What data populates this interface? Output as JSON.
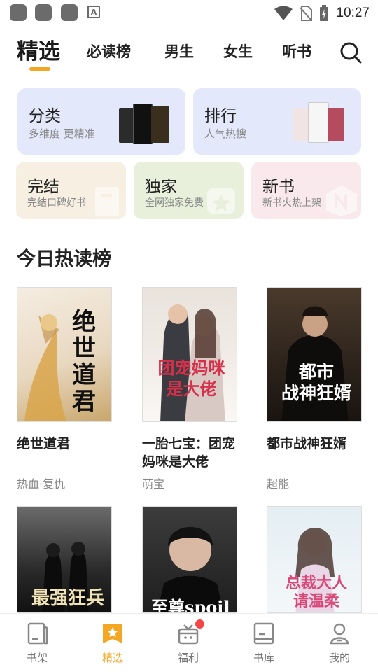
{
  "status_bar": {
    "time": "10:27",
    "left_icons": [
      "app-icon",
      "app-icon",
      "app-icon",
      "a-notification-icon"
    ],
    "right_icons": [
      "wifi-icon",
      "no-sim-icon",
      "battery-charging-icon"
    ]
  },
  "top_tabs": {
    "items": [
      {
        "label": "精选",
        "active": true
      },
      {
        "label": "必读榜",
        "active": false
      },
      {
        "label": "男生",
        "active": false
      },
      {
        "label": "女生",
        "active": false
      },
      {
        "label": "听书",
        "active": false
      }
    ],
    "accent": "#f5a623"
  },
  "categories": {
    "big": [
      {
        "title": "分类",
        "subtitle": "多维度 更精准",
        "bg": "#e3e9fb"
      },
      {
        "title": "排行",
        "subtitle": "人气热搜",
        "bg": "#e3e9fb"
      }
    ],
    "small": [
      {
        "title": "完结",
        "subtitle": "完结口碑好书",
        "bg": "#f6efe2"
      },
      {
        "title": "独家",
        "subtitle": "全网独家免费",
        "bg": "#e8f0dc"
      },
      {
        "title": "新书",
        "subtitle": "新书火热上架",
        "bg": "#f9e9ec"
      }
    ]
  },
  "hot_list": {
    "title": "今日热读榜",
    "books": [
      {
        "title": "绝世道君",
        "tag": "热血·复仇",
        "cover_text": "绝世道君"
      },
      {
        "title": "一胎七宝：团宠妈咪是大佬",
        "tag": "萌宝",
        "cover_text": "团宠妈咪是大佬"
      },
      {
        "title": "都市战神狂婿",
        "tag": "超能",
        "cover_text": "都市战神狂婿"
      },
      {
        "title": "",
        "tag": "",
        "cover_text": "都市之最强狂兵"
      },
      {
        "title": "",
        "tag": "",
        "cover_text": "至尊spoil"
      },
      {
        "title": "",
        "tag": "",
        "cover_text": "总裁大人请温柔"
      }
    ]
  },
  "bottom_nav": {
    "items": [
      {
        "label": "书架",
        "icon": "bookshelf-icon",
        "active": false
      },
      {
        "label": "精选",
        "icon": "featured-star-icon",
        "active": true
      },
      {
        "label": "福利",
        "icon": "gift-icon",
        "active": false,
        "badge": true
      },
      {
        "label": "书库",
        "icon": "library-icon",
        "active": false
      },
      {
        "label": "我的",
        "icon": "profile-icon",
        "active": false
      }
    ]
  }
}
